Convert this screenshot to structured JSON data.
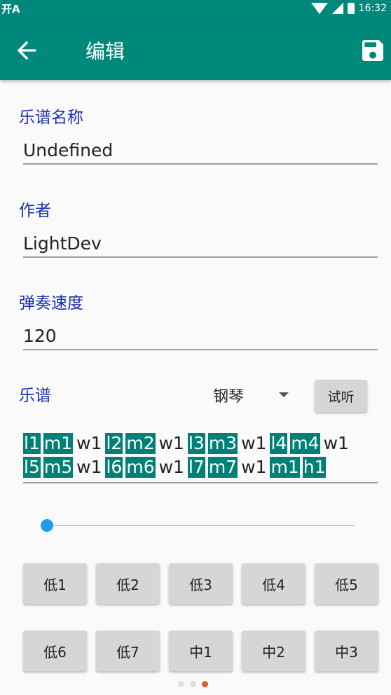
{
  "status": {
    "left": "开A",
    "time": "16:32"
  },
  "toolbar": {
    "title": "编辑"
  },
  "fields": {
    "name_label": "乐谱名称",
    "name_value": "Undefined",
    "author_label": "作者",
    "author_value": "LightDev",
    "speed_label": "弹奏速度",
    "speed_value": "120"
  },
  "score": {
    "label": "乐谱",
    "instrument": "钢琴",
    "preview_label": "试听",
    "line1": [
      {
        "t": "l1",
        "hl": true
      },
      {
        "t": "m1",
        "hl": true
      },
      {
        "t": "w1",
        "hl": false
      },
      {
        "t": "l2",
        "hl": true
      },
      {
        "t": "m2",
        "hl": true
      },
      {
        "t": "w1",
        "hl": false
      },
      {
        "t": "l3",
        "hl": true
      },
      {
        "t": "m3",
        "hl": true
      },
      {
        "t": "w1",
        "hl": false
      },
      {
        "t": "l4",
        "hl": true
      },
      {
        "t": "m4",
        "hl": true
      },
      {
        "t": "w1",
        "hl": false
      }
    ],
    "line2": [
      {
        "t": "l5",
        "hl": true
      },
      {
        "t": "m5",
        "hl": true
      },
      {
        "t": "w1",
        "hl": false
      },
      {
        "t": "l6",
        "hl": true
      },
      {
        "t": "m6",
        "hl": true
      },
      {
        "t": "w1",
        "hl": false
      },
      {
        "t": "l7",
        "hl": true
      },
      {
        "t": "m7",
        "hl": true
      },
      {
        "t": "w1",
        "hl": false
      },
      {
        "t": "m1",
        "hl": true
      },
      {
        "t": "h1",
        "hl": true
      }
    ]
  },
  "slider": {
    "value": 0
  },
  "keys": {
    "row1": [
      "低1",
      "低2",
      "低3",
      "低4",
      "低5"
    ],
    "row2": [
      "低6",
      "低7",
      "中1",
      "中2",
      "中3"
    ]
  },
  "pager": {
    "count": 3,
    "active": 2
  },
  "colors": {
    "primary": "#00897b",
    "accent_label": "#1a2faf",
    "note_highlight": "#008175",
    "slider": "#1e9bf0",
    "page_indicator": "#e05a33"
  }
}
